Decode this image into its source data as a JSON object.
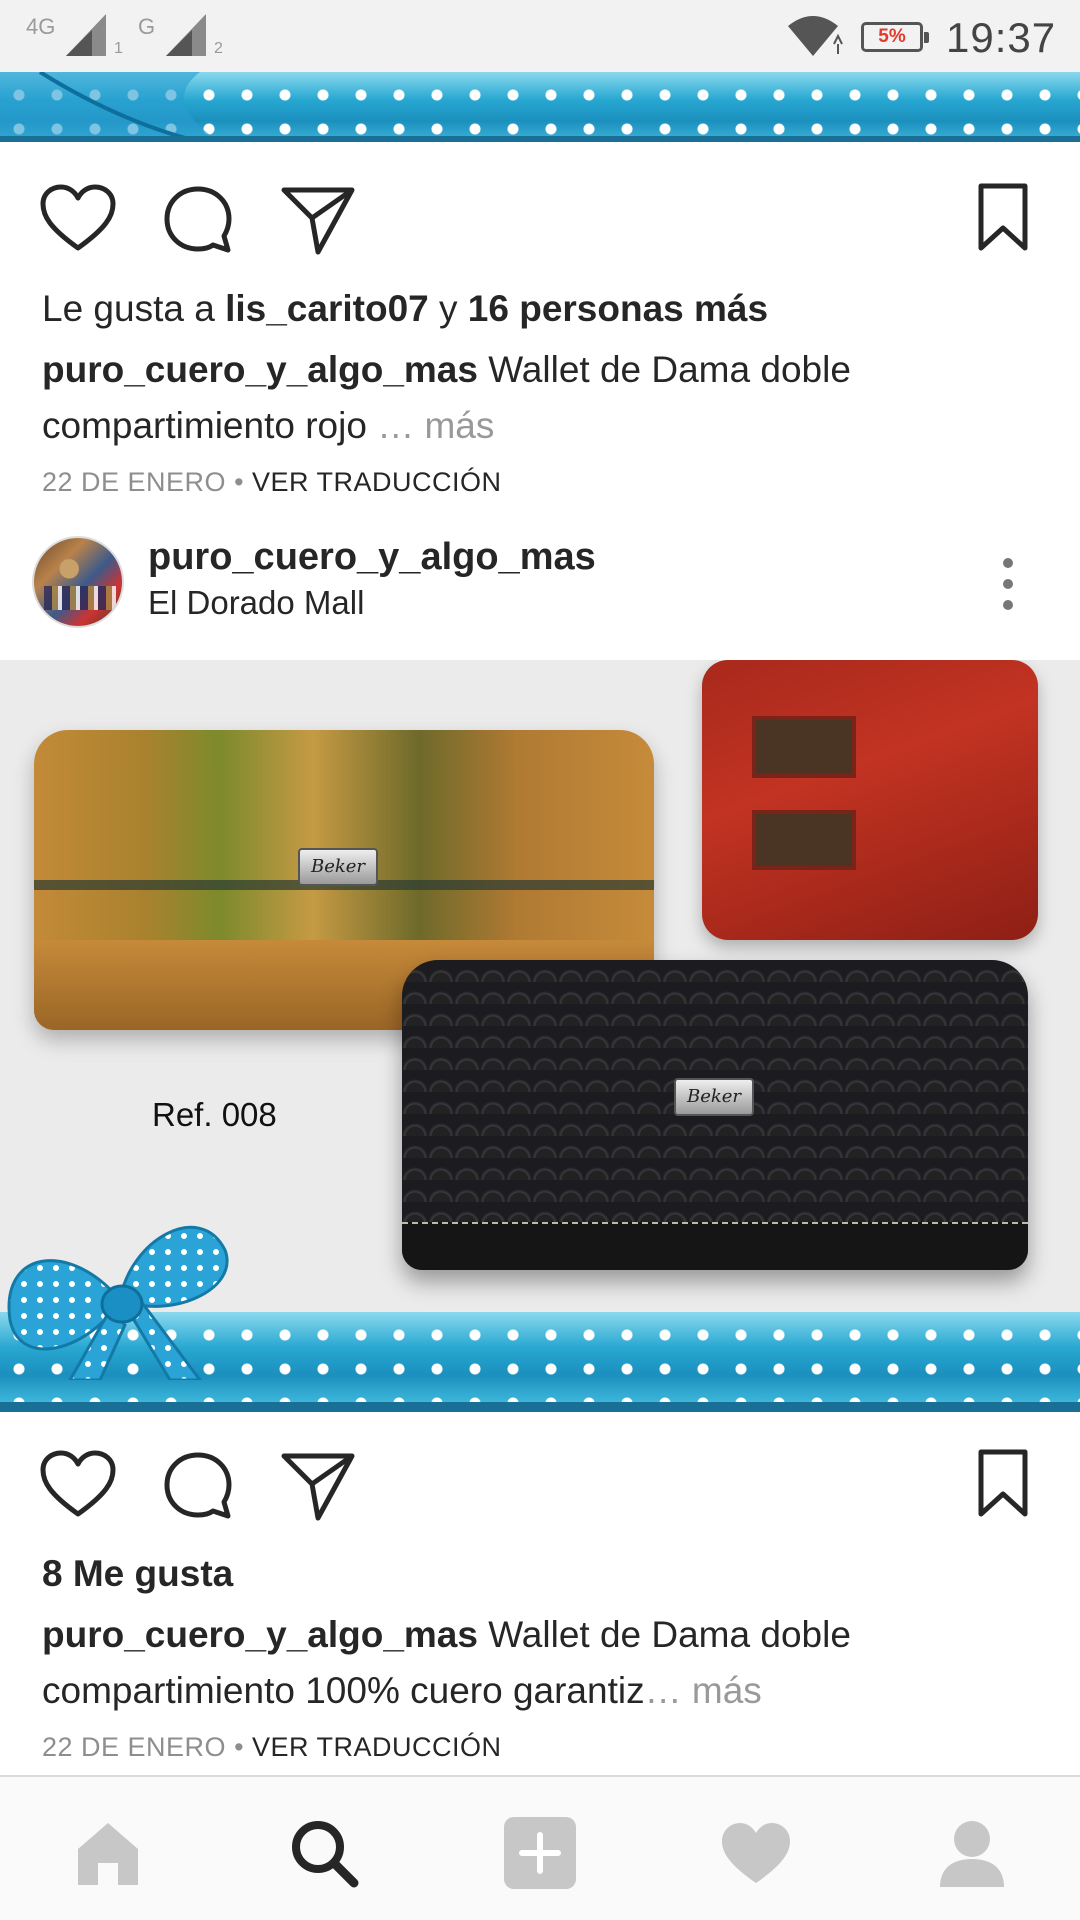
{
  "status_bar": {
    "sim1_label": "4G",
    "sim1_index": "1",
    "sim2_label": "G",
    "sim2_index": "2",
    "battery": "5%",
    "time": "19:37"
  },
  "post_previous": {
    "likes_prefix": "Le gusta a ",
    "likes_user": "lis_carito07",
    "likes_and": " y ",
    "likes_others": "16 personas más",
    "caption_user": "puro_cuero_y_algo_mas",
    "caption_line1": " Wallet de Dama doble",
    "caption_line2": "compartimiento rojo ",
    "caption_more": "… más",
    "date": "22 DE ENERO",
    "separator": " • ",
    "translate": "VER TRADUCCIÓN"
  },
  "post": {
    "username": "puro_cuero_y_algo_mas",
    "location": "El Dorado Mall",
    "image": {
      "ref_label": "Ref. 008",
      "brand": "Beker"
    },
    "likes": "8 Me gusta",
    "caption_user": "puro_cuero_y_algo_mas",
    "caption_line1": " Wallet de Dama doble",
    "caption_line2": "compartimiento 100% cuero garantiz",
    "caption_more": "… más",
    "date": "22 DE ENERO",
    "separator": " • ",
    "translate": "VER TRADUCCIÓN"
  },
  "icons": {
    "like": "heart-icon",
    "comment": "comment-icon",
    "share": "send-icon",
    "save": "bookmark-icon",
    "more": "more-vertical-icon",
    "nav": [
      "home-icon",
      "search-icon",
      "add-icon",
      "activity-heart-icon",
      "profile-icon"
    ]
  },
  "colors": {
    "text": "#262626",
    "muted": "#999999",
    "nav_active": "#262626",
    "nav_inactive": "#c7c7c7",
    "ribbon": "#28a9d3",
    "battery_low": "#e03b2c"
  }
}
